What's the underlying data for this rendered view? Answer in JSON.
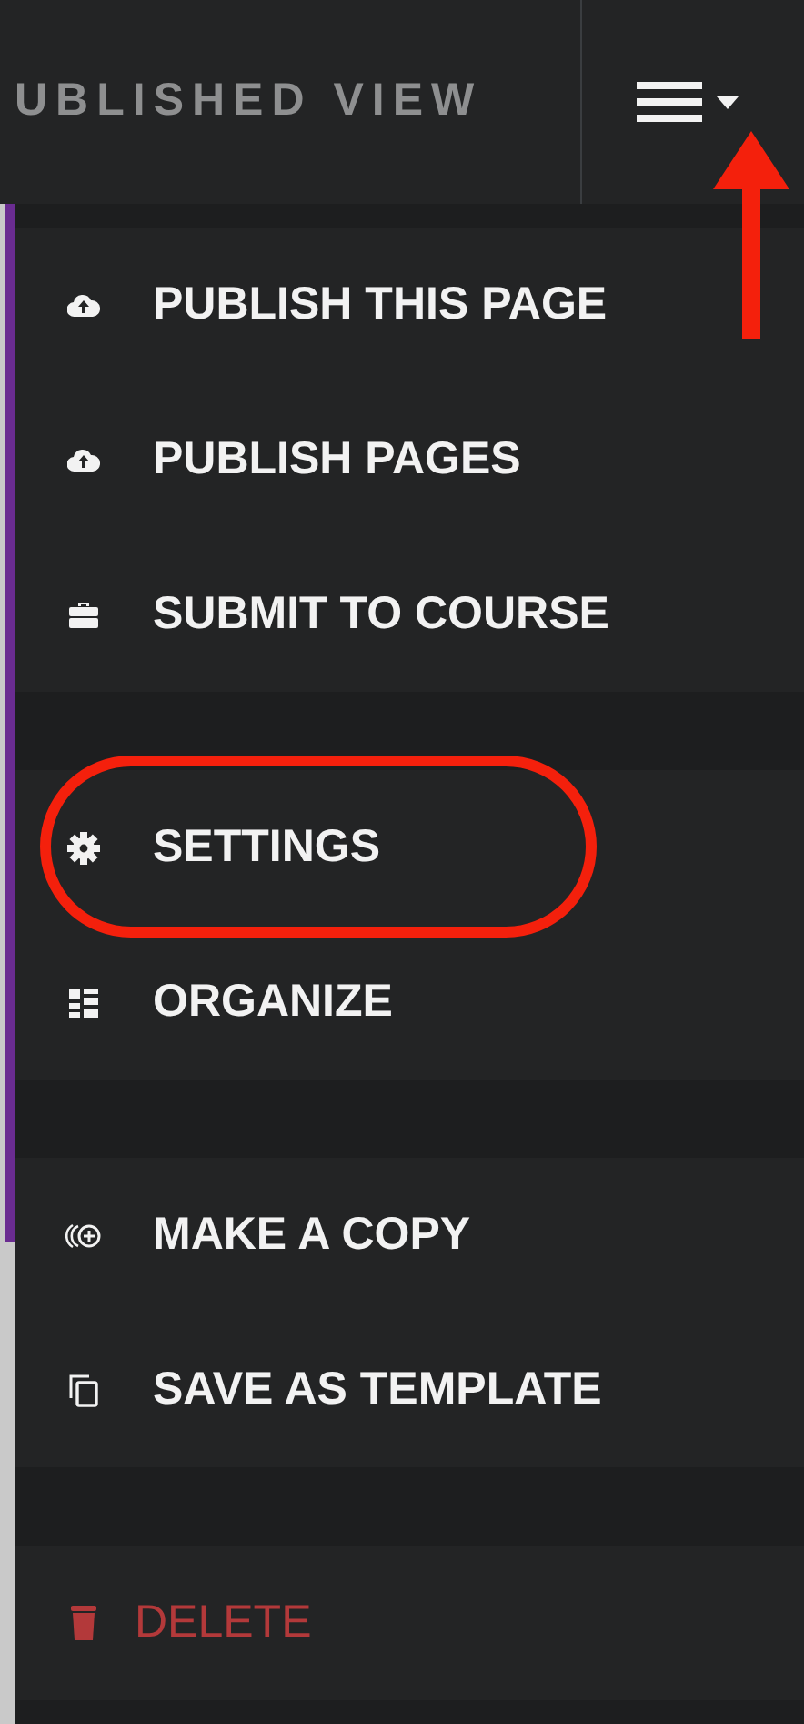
{
  "header": {
    "title": "UBLISHED VIEW"
  },
  "menu": {
    "groups": [
      {
        "items": [
          {
            "label": "PUBLISH THIS PAGE",
            "kind": "normal",
            "highlighted": false
          },
          {
            "label": "PUBLISH PAGES",
            "kind": "normal",
            "highlighted": false
          },
          {
            "label": "SUBMIT TO COURSE",
            "kind": "normal",
            "highlighted": false
          }
        ]
      },
      {
        "items": [
          {
            "label": "SETTINGS",
            "kind": "normal",
            "highlighted": true
          },
          {
            "label": "ORGANIZE",
            "kind": "normal",
            "highlighted": false
          }
        ]
      },
      {
        "items": [
          {
            "label": "MAKE A COPY",
            "kind": "normal",
            "highlighted": false
          },
          {
            "label": "SAVE AS TEMPLATE",
            "kind": "normal",
            "highlighted": false
          }
        ]
      },
      {
        "items": [
          {
            "label": "DELETE",
            "kind": "danger",
            "highlighted": false
          }
        ]
      }
    ]
  }
}
